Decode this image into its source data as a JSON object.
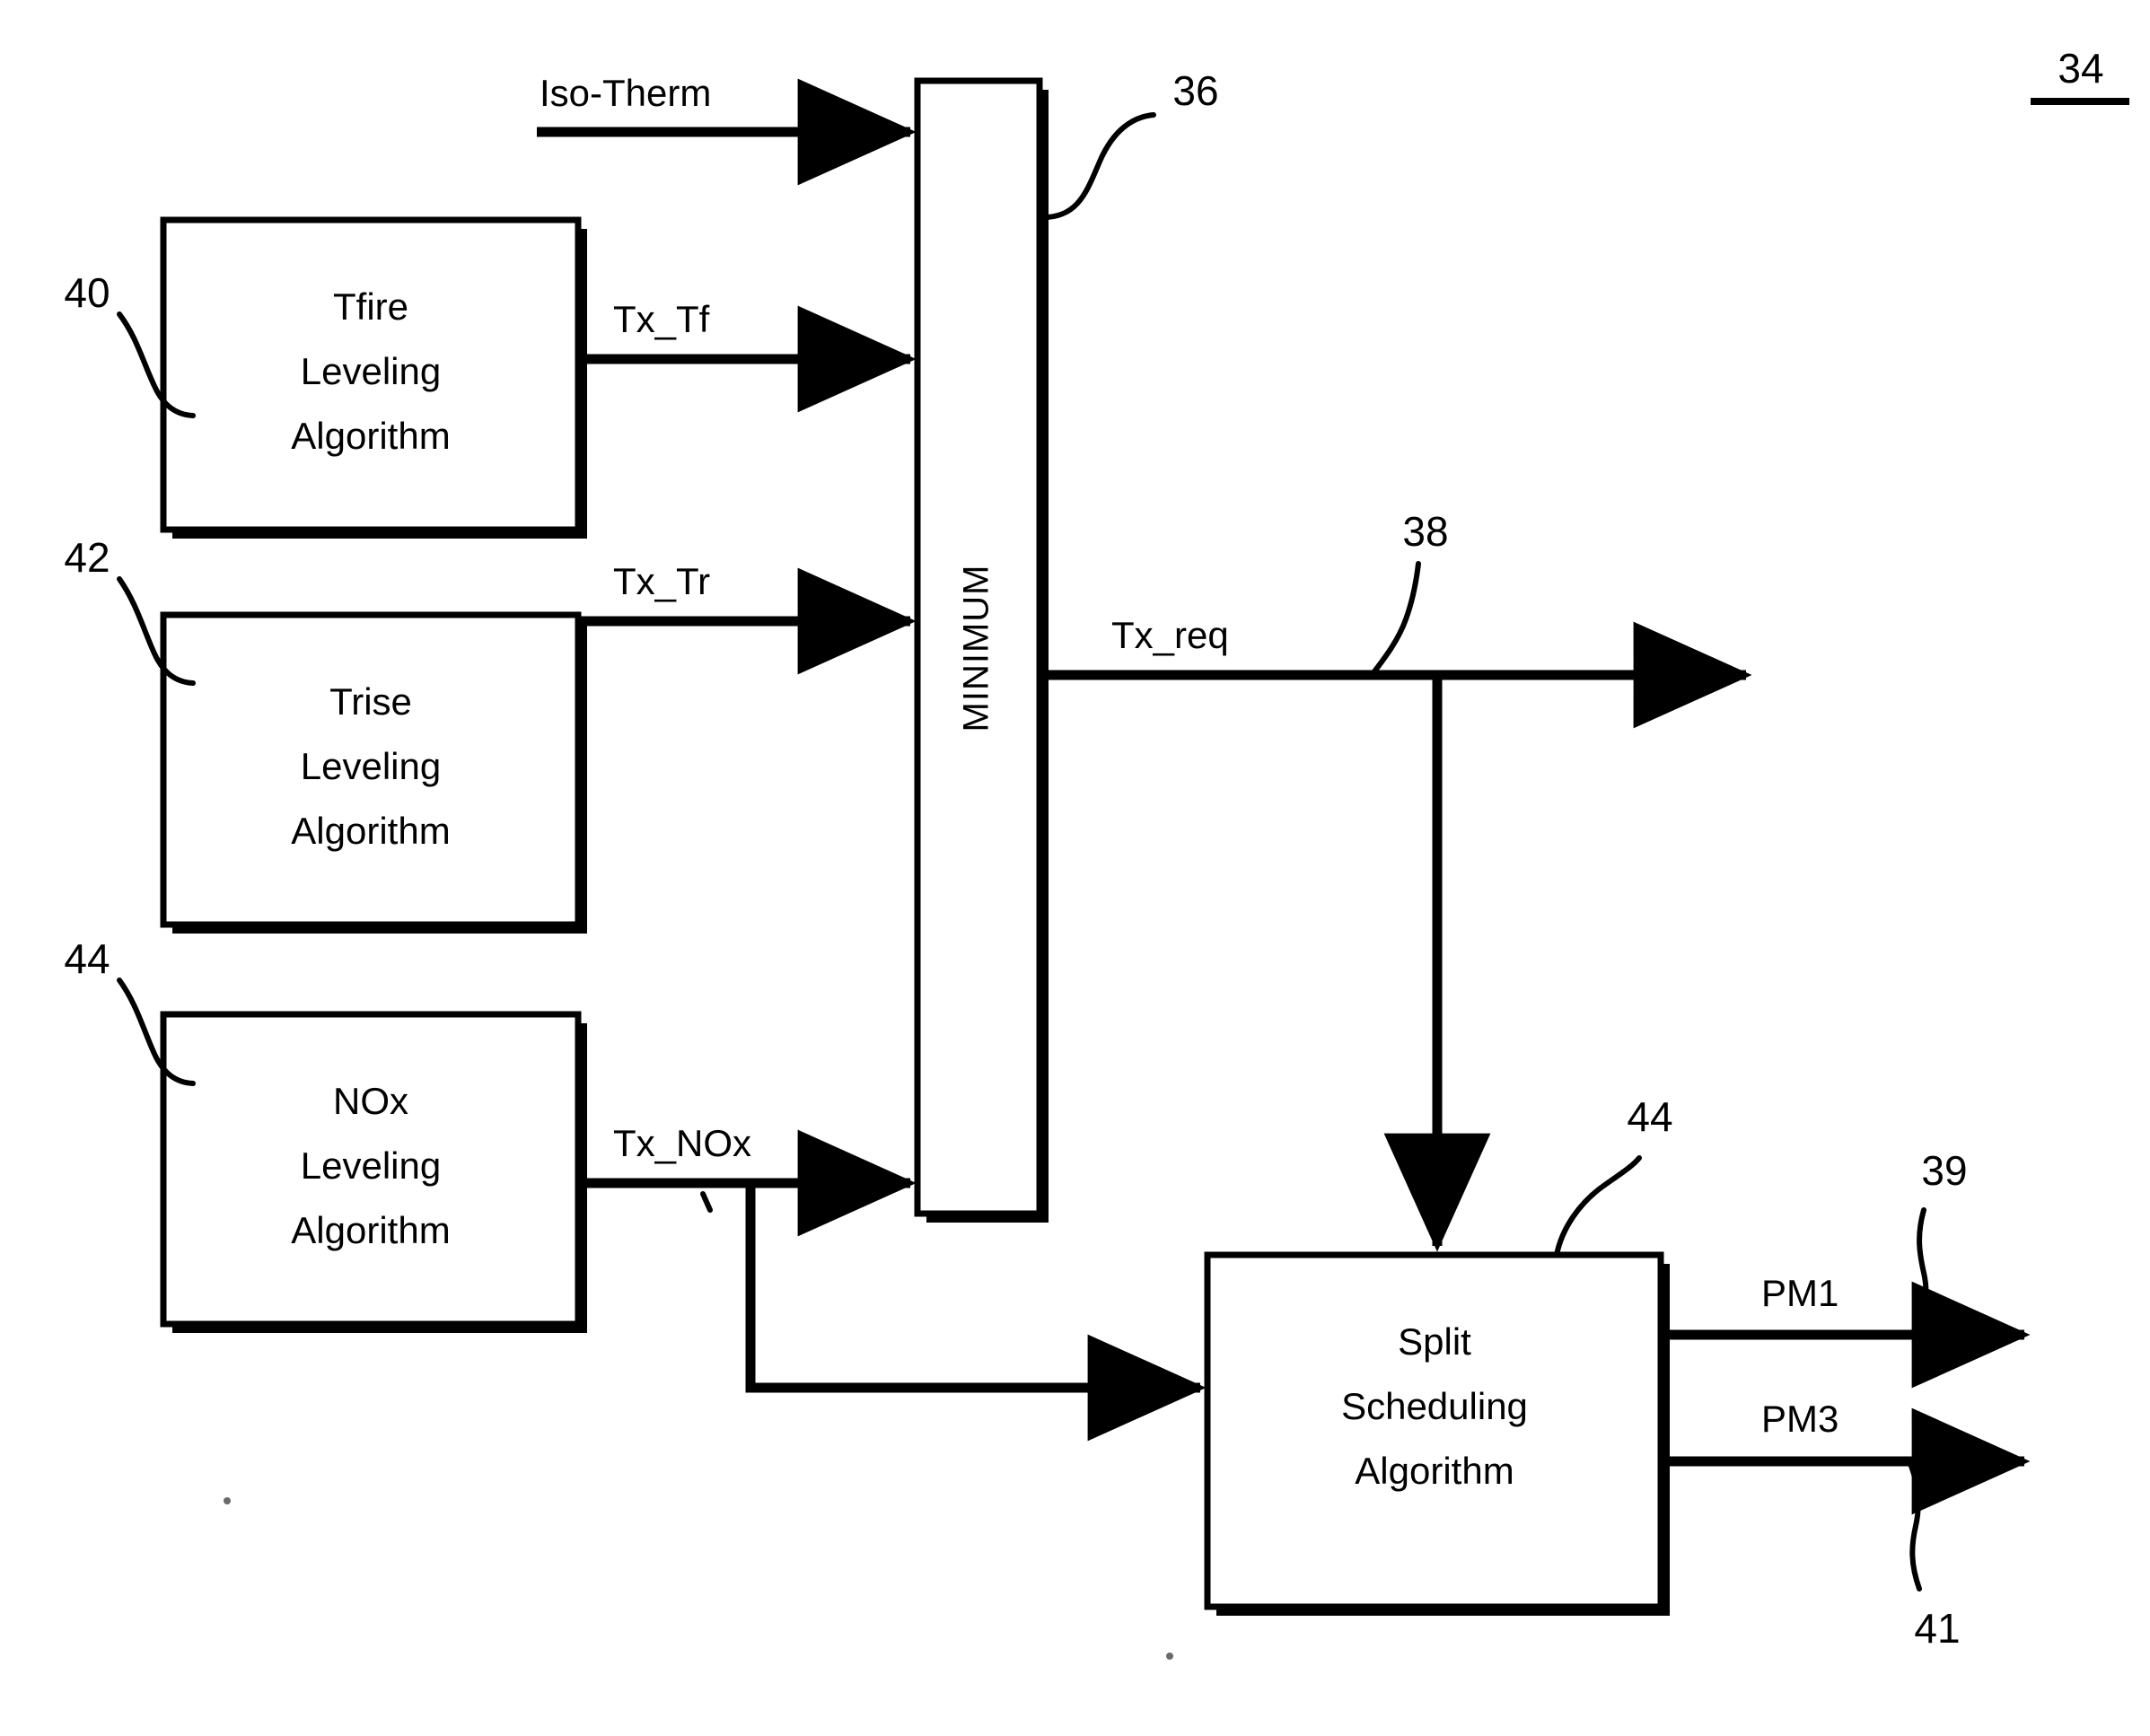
{
  "figure": {
    "figure_number": "34",
    "blocks": [
      {
        "id": "tfire",
        "lines": [
          "Tfire",
          "Leveling",
          "Algorithm"
        ],
        "ref": "40"
      },
      {
        "id": "trise",
        "lines": [
          "Trise",
          "Leveling",
          "Algorithm"
        ],
        "ref": "42"
      },
      {
        "id": "nox",
        "lines": [
          "NOx",
          "Leveling",
          "Algorithm"
        ],
        "ref": "44"
      },
      {
        "id": "split",
        "lines": [
          "Split",
          "Scheduling",
          "Algorithm"
        ],
        "ref": "44"
      }
    ],
    "minimum_block": {
      "label": "MINIMUM",
      "ref": "36"
    },
    "signals": {
      "iso_therm": "Iso-Therm",
      "tx_tf": "Tx_Tf",
      "tx_tr": "Tx_Tr",
      "tx_nox": "Tx_NOx",
      "tx_req": "Tx_req",
      "pm1": "PM1",
      "pm3": "PM3"
    },
    "reference_numerals": {
      "figure": "34",
      "minimum": "36",
      "tx_req_line": "38",
      "pm1_line": "39",
      "tfire_block": "40",
      "pm3_line": "41",
      "trise_block": "42",
      "nox_block": "44",
      "split_block": "44"
    },
    "colors": {
      "ink": "#000000",
      "paper": "#ffffff"
    }
  }
}
